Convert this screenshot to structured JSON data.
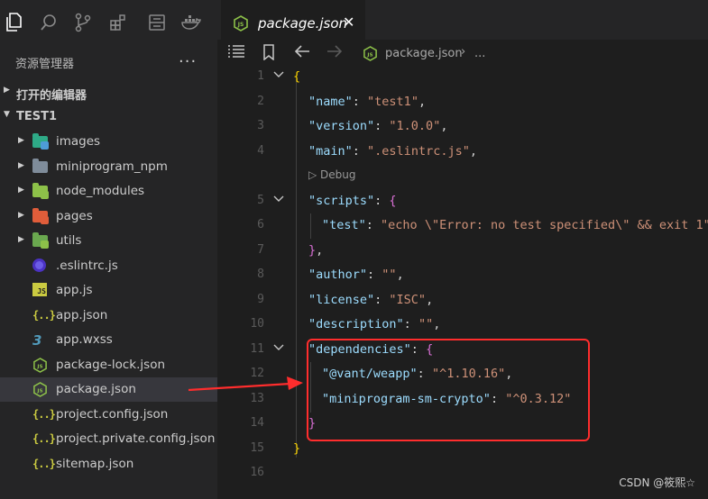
{
  "activity_bar": {
    "icons": [
      "files-icon",
      "search-icon",
      "source-control-icon",
      "extensions-icon",
      "storage-icon",
      "docker-icon"
    ]
  },
  "explorer": {
    "title": "资源管理器",
    "more": "...",
    "open_editors_label": "打开的编辑器",
    "project_label": "TEST1",
    "tree": [
      {
        "name": "images",
        "kind": "folder",
        "color": "#2eaa87",
        "badge": "#4e9cd8"
      },
      {
        "name": "miniprogram_npm",
        "kind": "folder",
        "color": "#7f8c9a",
        "badge": ""
      },
      {
        "name": "node_modules",
        "kind": "folder",
        "color": "#8dc149",
        "badge": "#8dc149"
      },
      {
        "name": "pages",
        "kind": "folder",
        "color": "#e05d3a",
        "badge": "#e05d3a"
      },
      {
        "name": "utils",
        "kind": "folder",
        "color": "#6aa84f",
        "badge": "#8dc149"
      },
      {
        "name": ".eslintrc.js",
        "kind": "eslint"
      },
      {
        "name": "app.js",
        "kind": "js"
      },
      {
        "name": "app.json",
        "kind": "json"
      },
      {
        "name": "app.wxss",
        "kind": "css"
      },
      {
        "name": "package-lock.json",
        "kind": "node"
      },
      {
        "name": "package.json",
        "kind": "node",
        "selected": true
      },
      {
        "name": "project.config.json",
        "kind": "json"
      },
      {
        "name": "project.private.config.json",
        "kind": "json"
      },
      {
        "name": "sitemap.json",
        "kind": "json"
      }
    ]
  },
  "tab": {
    "title": "package.json",
    "close": "✕",
    "icon_text": "JS"
  },
  "breadcrumb": {
    "file": "package.json",
    "separator": "›",
    "more": "..."
  },
  "codelens": "▷ Debug",
  "code_lines": [
    {
      "n": "1",
      "fold": true
    },
    {
      "n": "2"
    },
    {
      "n": "3"
    },
    {
      "n": "4"
    },
    {
      "n": "5",
      "fold": true
    },
    {
      "n": "6"
    },
    {
      "n": "7"
    },
    {
      "n": "8"
    },
    {
      "n": "9"
    },
    {
      "n": "10"
    },
    {
      "n": "11",
      "fold": true
    },
    {
      "n": "12"
    },
    {
      "n": "13"
    },
    {
      "n": "14"
    },
    {
      "n": "15"
    },
    {
      "n": "16"
    }
  ],
  "code": {
    "open_brace": "{",
    "name_key": "\"name\"",
    "name_val": "\"test1\"",
    "version_key": "\"version\"",
    "version_val": "\"1.0.0\"",
    "main_key": "\"main\"",
    "main_val": "\".eslintrc.js\"",
    "scripts_key": "\"scripts\"",
    "test_key": "\"test\"",
    "test_val": "\"echo \\\"Error: no test specified\\\" && exit 1\"",
    "scripts_close": "}",
    "author_key": "\"author\"",
    "author_val": "\"\"",
    "license_key": "\"license\"",
    "license_val": "\"ISC\"",
    "description_key": "\"description\"",
    "description_val": "\"\"",
    "deps_key": "\"dependencies\"",
    "vant_key": "\"@vant/weapp\"",
    "vant_val": "\"^1.10.16\"",
    "crypto_key": "\"miniprogram-sm-crypto\"",
    "crypto_val": "\"^0.3.12\"",
    "deps_close": "}",
    "close_brace": "}"
  },
  "watermark": "CSDN @筱熙☆",
  "colors": {
    "annotation_red": "#ff2d2d",
    "string": "#ce9178",
    "key": "#9cdcfe",
    "bracket_gold": "#ffd700",
    "bracket_violet": "#da70d6"
  }
}
